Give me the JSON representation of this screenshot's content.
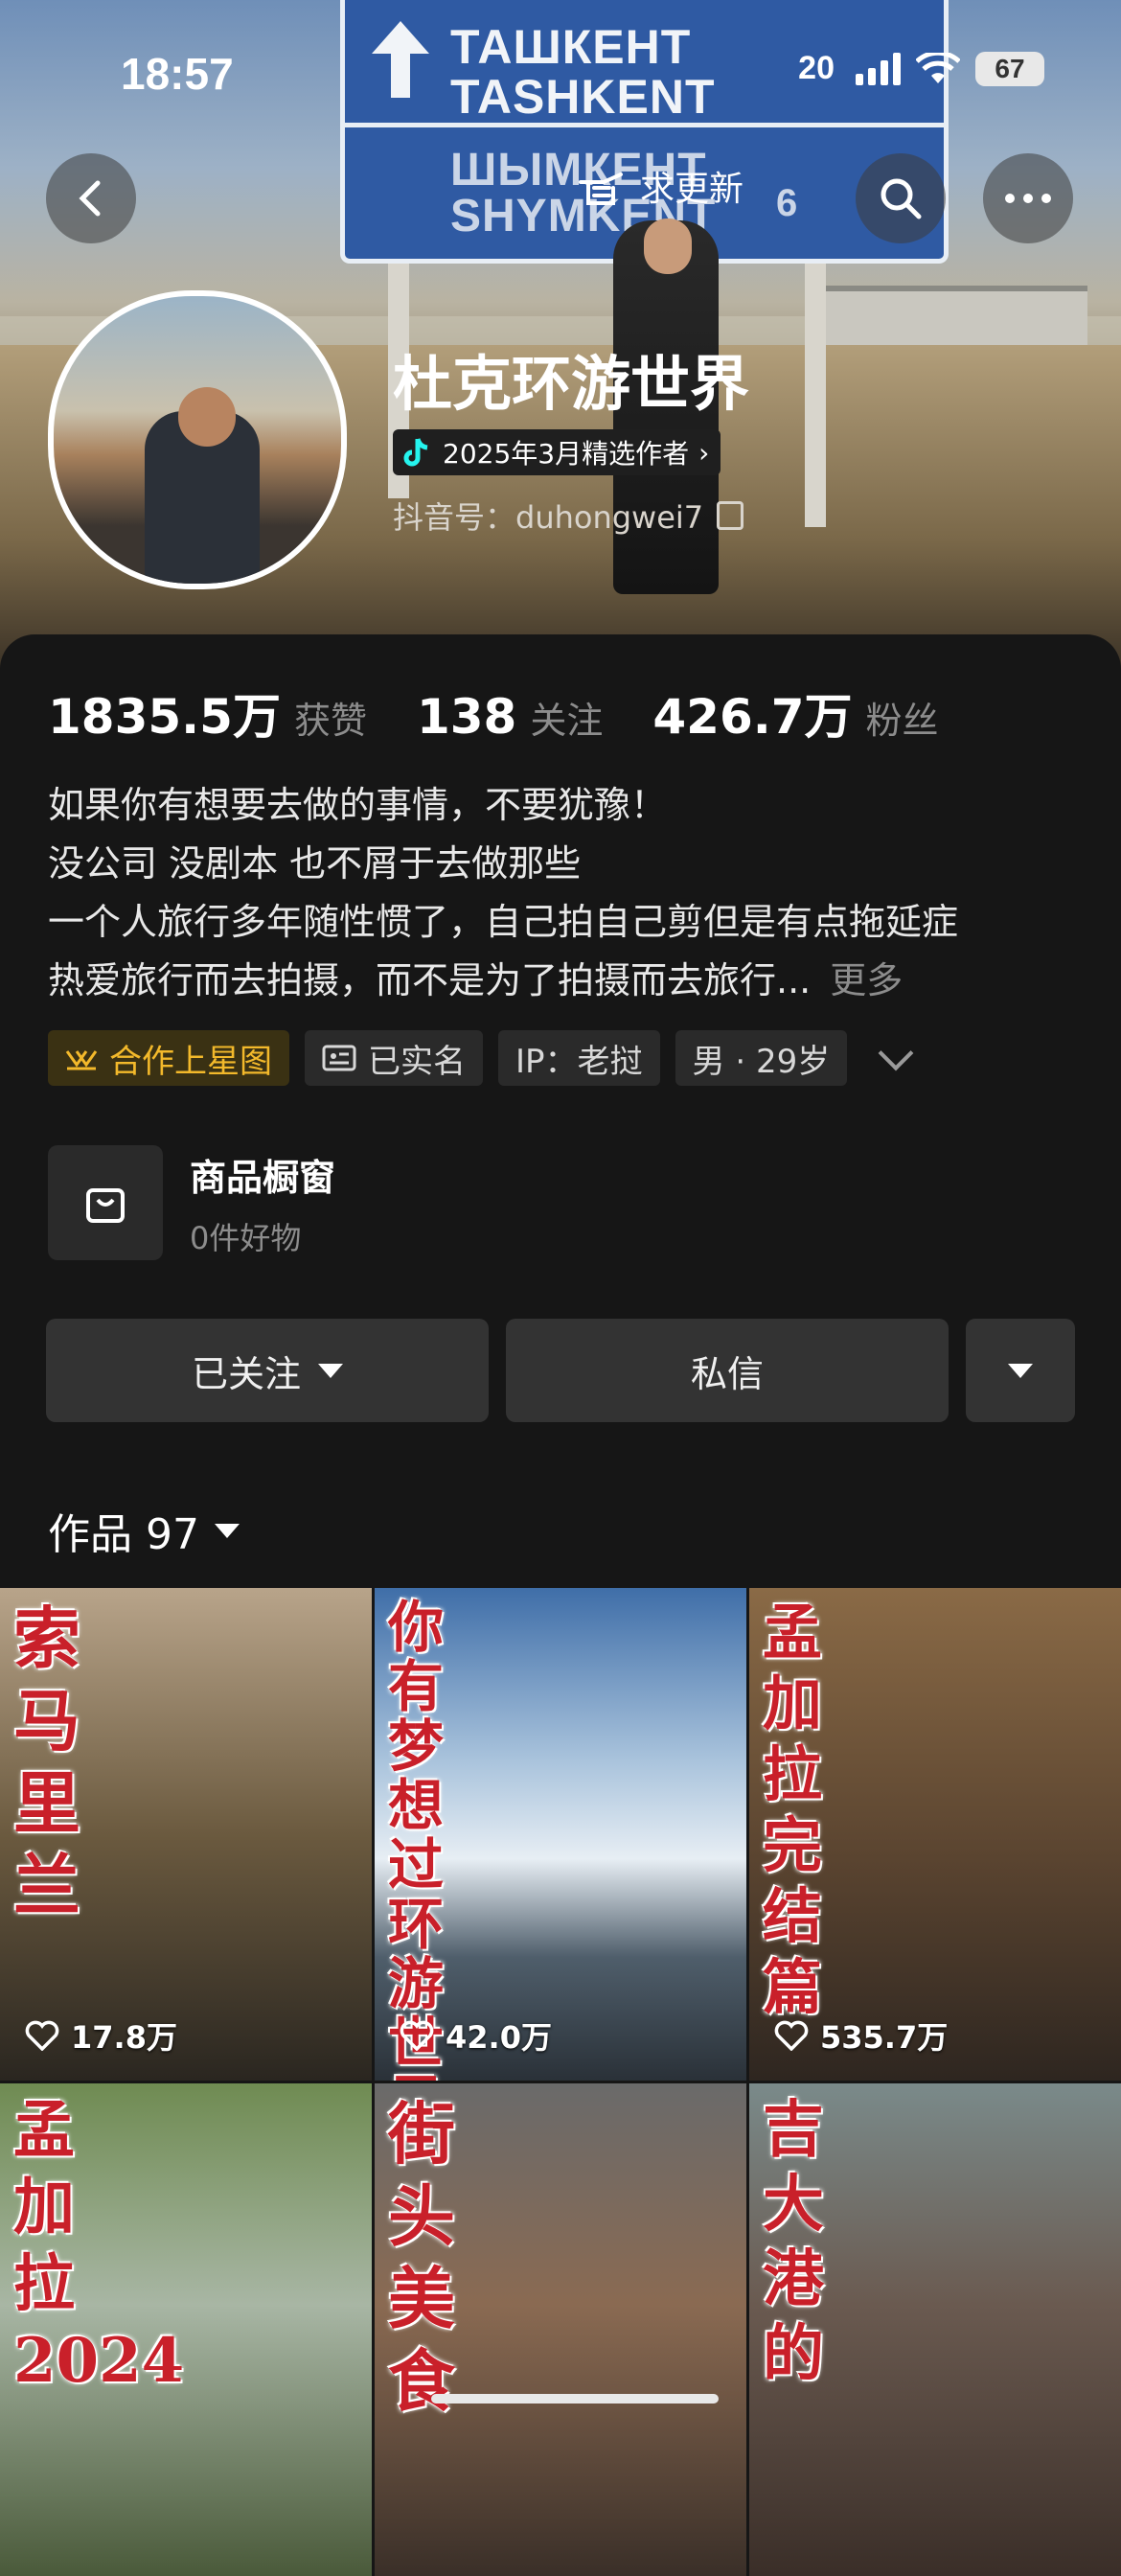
{
  "status_bar": {
    "time": "18:57",
    "signal_label": "20",
    "battery": "67"
  },
  "sign": {
    "line1_ru": "ТАШКЕНТ",
    "line1_en": "TASHKENT",
    "line2_ru": "ШЫМКЕНТ",
    "line2_en": "SHYMKENT",
    "line2_num": "6"
  },
  "nav": {
    "update_label": "求更新"
  },
  "profile": {
    "name": "杜克环游世界",
    "badge": "2025年3月精选作者",
    "douyin_id": "抖音号：duhongwei7"
  },
  "stats": [
    {
      "value": "1835.5万",
      "label": "获赞"
    },
    {
      "value": "138",
      "label": "关注"
    },
    {
      "value": "426.7万",
      "label": "粉丝"
    }
  ],
  "bio": {
    "lines": [
      "如果你有想要去做的事情，不要犹豫！",
      "没公司 没剧本 也不屑于去做那些",
      "一个人旅行多年随性惯了，自己拍自己剪但是有点拖延症",
      "热爱旅行而去拍摄，而不是为了拍摄而去旅行..."
    ],
    "more": "更多"
  },
  "tags": [
    "合作上星图",
    "已实名",
    "IP：老挝",
    "男 · 29岁"
  ],
  "shop": {
    "title": "商品橱窗",
    "subtitle": "0件好物"
  },
  "actions": {
    "follow": "已关注",
    "message": "私信"
  },
  "works": {
    "label": "作品 97"
  },
  "videos": [
    {
      "caption": "索马里兰",
      "likes": "17.8万",
      "bg": "#6b5a3f"
    },
    {
      "caption": "你有梦想过环游世界吗",
      "likes": "42.0万",
      "bg": "#3f6ea8"
    },
    {
      "caption": "孟加拉完结篇",
      "likes": "535.7万",
      "bg": "#7a5a3a"
    },
    {
      "caption": "孟加拉2024",
      "likes": "",
      "bg": "#6f8b52"
    },
    {
      "caption": "街头美食",
      "likes": "",
      "bg": "#5a4a3a"
    },
    {
      "caption": "吉大港的",
      "likes": "",
      "bg": "#6a5a50"
    }
  ],
  "colors": {
    "accent_gold": "#f3b92b",
    "caption_red": "#c9202a",
    "background": "#161616"
  }
}
